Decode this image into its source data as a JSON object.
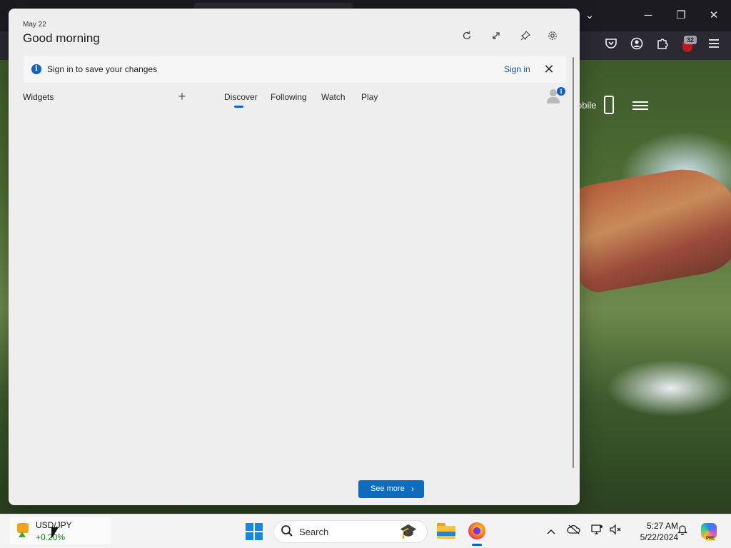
{
  "browser": {
    "window_controls": {
      "dropdown": "⌄",
      "minimize": "─",
      "restore": "❐",
      "close": "✕"
    },
    "toolbar_icons": {
      "pocket": "pocket-icon",
      "account": "account-icon",
      "extensions": "puzzle-icon",
      "ublock": "ublock-icon",
      "menu": "menu-icon"
    },
    "ublock_badge": "32",
    "site_text": "obile"
  },
  "widgets": {
    "date": "May 22",
    "greeting": "Good morning",
    "header_buttons": [
      "refresh-icon",
      "expand-icon",
      "pin-icon",
      "settings-icon"
    ],
    "signin_bar": {
      "message": "Sign in to save your changes",
      "link": "Sign in",
      "close": "✕",
      "info_icon": "i"
    },
    "widgets_label": "Widgets",
    "add_widget": "+",
    "tabs": [
      {
        "label": "Discover",
        "active": true
      },
      {
        "label": "Following",
        "active": false
      },
      {
        "label": "Watch",
        "active": false
      },
      {
        "label": "Play",
        "active": false
      }
    ],
    "profile_badge": "i",
    "see_more": "See more",
    "see_more_chevron": "›",
    "accent_color": "#0f62c4"
  },
  "taskbar": {
    "weather_widget": {
      "title": "USD/JPY",
      "change": "+0.20%"
    },
    "search": {
      "label": "Search",
      "art": "🎓"
    },
    "tray": {
      "chevron": "^",
      "cloud": "☁",
      "network": "🖧",
      "volume": "🔇",
      "notifications": "🔔"
    },
    "clock": {
      "time": "5:27 AM",
      "date": "5/22/2024"
    },
    "copilot_label": "PRE"
  }
}
